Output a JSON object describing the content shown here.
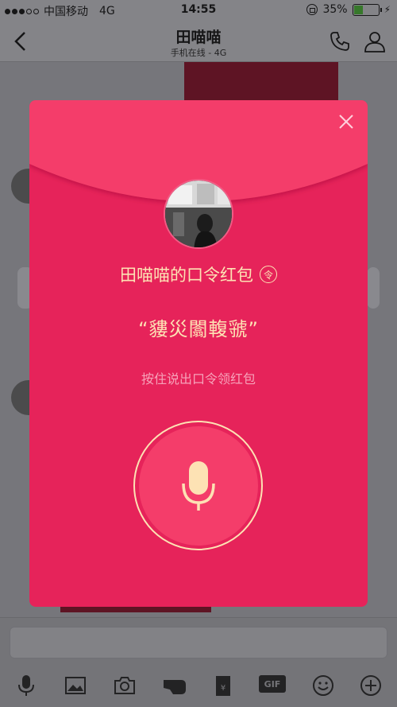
{
  "status_bar": {
    "carrier": "中国移动",
    "network": "4G",
    "time": "14:55",
    "battery": "35%"
  },
  "nav": {
    "title": "田喵喵",
    "subtitle": "手机在线 - 4G"
  },
  "packet": {
    "title": "田喵喵的口令红包",
    "badge": "令",
    "password": "“貗災闟輹虢”",
    "hint": "按住说出口令领红包"
  },
  "toolbar": {
    "gif_label": "GIF"
  },
  "colors": {
    "packet_red": "#e6235a",
    "flap_red": "#f43d6a",
    "gold": "#fde2b4"
  }
}
